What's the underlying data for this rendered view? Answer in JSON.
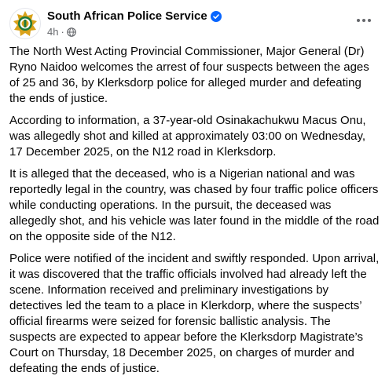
{
  "header": {
    "page_name": "South African Police Service",
    "timestamp": "4h",
    "separator": "·",
    "verified_icon": "verified-badge-icon",
    "audience_icon": "globe-icon",
    "more_icon": "more-options-icon"
  },
  "post": {
    "paragraphs": [
      "The North West Acting Provincial Commissioner, Major General (Dr) Ryno Naidoo welcomes the arrest of four suspects between the ages of 25 and 36, by Klerksdorp police for alleged murder and defeating the ends of justice.",
      "According to information, a 37-year-old Osinakachukwu Macus Onu, was allegedly shot and killed at approximately 03:00 on Wednesday, 17 December 2025, on the N12 road in Klerksdorp.",
      "It is alleged that the deceased, who is a Nigerian national and was reportedly legal in the country, was chased by four traffic police officers while conducting operations. In the pursuit, the deceased was allegedly shot, and his vehicle was later found in the middle of the road on the opposite side of the N12.",
      "Police were notified of the incident and swiftly responded. Upon arrival, it was discovered that the traffic officials involved had already left the scene. Information received and preliminary investigations by detectives led the team to a place in Klerkdorp, where the suspects’ official firearms were seized for forensic ballistic analysis. The suspects are expected to appear before the Klerksdorp Magistrate’s Court on Thursday, 18 December 2025, on charges of murder and defeating the ends of justice."
    ]
  },
  "colors": {
    "text_primary": "#050505",
    "text_secondary": "#65676b",
    "verified_blue": "#0866ff",
    "badge_gold": "#d9a21b",
    "badge_green": "#1f7a3a"
  }
}
